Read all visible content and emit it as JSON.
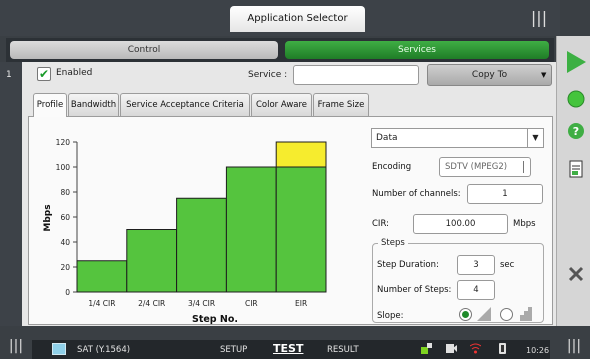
{
  "header": {
    "app_selector": "Application Selector"
  },
  "main_tabs": {
    "control": "Control",
    "services": "Services"
  },
  "service_row": {
    "index": "1",
    "enabled_label": "Enabled",
    "enabled": true,
    "service_label": "Service :",
    "service_value": "",
    "copy_to": "Copy To"
  },
  "profile_tabs": [
    "Profile",
    "Bandwidth",
    "Service Acceptance Criteria",
    "Color Aware",
    "Frame Size"
  ],
  "chart_data": {
    "type": "bar",
    "xlabel": "Step No.",
    "ylabel": "Mbps",
    "ylim": [
      0,
      120
    ],
    "yticks": [
      0,
      20,
      40,
      60,
      80,
      100,
      120
    ],
    "categories": [
      "1/4 CIR",
      "2/4 CIR",
      "3/4 CIR",
      "CIR",
      "EIR"
    ],
    "series": [
      {
        "values": [
          25,
          50,
          75,
          100,
          100
        ],
        "color": "#55c43e"
      },
      {
        "values": [
          0,
          0,
          0,
          0,
          20
        ],
        "color": "#f6ec2e"
      }
    ],
    "grid": false
  },
  "form": {
    "data_select": "Data",
    "encoding_label": "Encoding",
    "encoding_value": "SDTV (MPEG2)",
    "channels_label": "Number of channels:",
    "channels_value": "1",
    "cir_label": "CIR:",
    "cir_value": "100.00",
    "cir_unit": "Mbps",
    "steps_label": "Steps",
    "step_duration_label": "Step Duration:",
    "step_duration_value": "3",
    "step_duration_unit": "sec",
    "num_steps_label": "Number of Steps:",
    "num_steps_value": "4",
    "slope_label": "Slope:"
  },
  "footer": {
    "test_name": "SAT (Y.1564)",
    "nav_setup": "SETUP",
    "nav_test": "TEST",
    "nav_result": "RESULT",
    "time": "10:26"
  },
  "colors": {
    "accent_green": "#2a9a33",
    "bar_fill": "#55c43e",
    "eir_fill": "#f6ec2e"
  }
}
